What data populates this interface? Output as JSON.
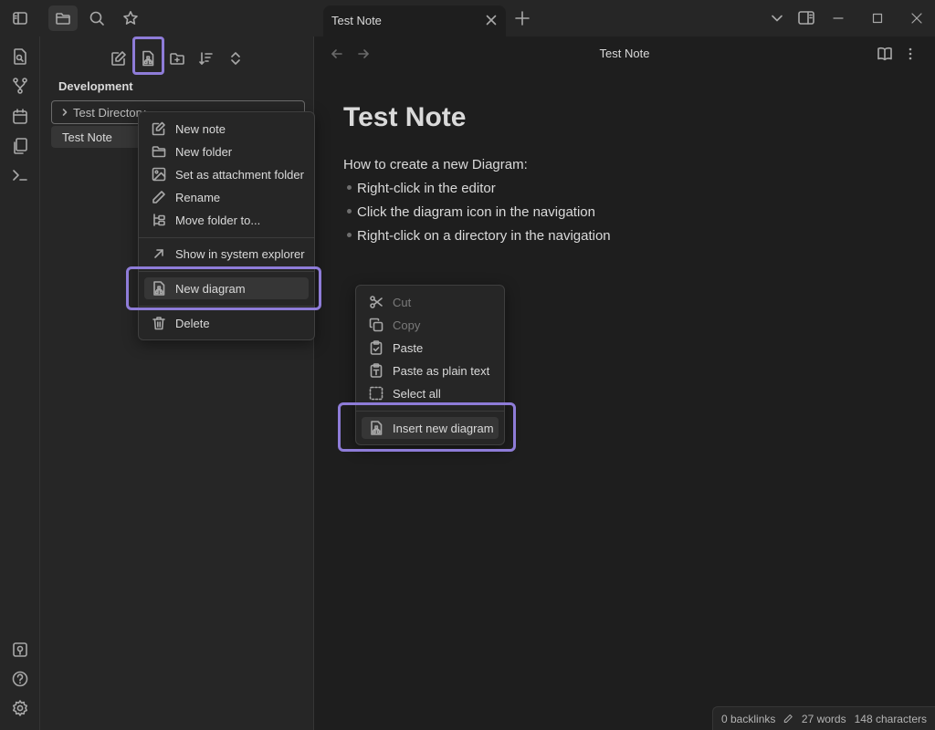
{
  "tab": {
    "title": "Test Note"
  },
  "sidebar": {
    "vault_name": "Development",
    "folder": "Test Directory",
    "note": "Test Note"
  },
  "folder_menu": {
    "items": [
      {
        "label": "New note",
        "icon": "edit-icon"
      },
      {
        "label": "New folder",
        "icon": "folder-icon"
      },
      {
        "label": "Set as attachment folder",
        "icon": "image-icon"
      },
      {
        "label": "Rename",
        "icon": "pencil-icon"
      },
      {
        "label": "Move folder to...",
        "icon": "move-icon"
      },
      {
        "label": "Show in system explorer",
        "icon": "arrow-up-right-icon"
      },
      {
        "label": "New diagram",
        "icon": "diagram-icon"
      },
      {
        "label": "Delete",
        "icon": "trash-icon"
      }
    ]
  },
  "editor": {
    "title": "Test Note",
    "heading": "Test Note",
    "paragraph": "How to create a new Diagram:",
    "bullets": [
      "Right-click in the editor",
      "Click the diagram icon in the navigation",
      "Right-click on a directory in the navigation"
    ]
  },
  "editor_menu": {
    "items": [
      {
        "label": "Cut",
        "icon": "scissors-icon",
        "enabled": false
      },
      {
        "label": "Copy",
        "icon": "copy-icon",
        "enabled": false
      },
      {
        "label": "Paste",
        "icon": "clipboard-check-icon",
        "enabled": true
      },
      {
        "label": "Paste as plain text",
        "icon": "clipboard-type-icon",
        "enabled": true
      },
      {
        "label": "Select all",
        "icon": "select-all-icon",
        "enabled": true
      },
      {
        "label": "Insert new diagram",
        "icon": "diagram-icon",
        "enabled": true
      }
    ]
  },
  "status": {
    "backlinks": "0 backlinks",
    "words": "27 words",
    "characters": "148 characters"
  },
  "colors": {
    "accent": "#8e7cd8",
    "background": "#1e1e1e",
    "panel": "#262626"
  }
}
